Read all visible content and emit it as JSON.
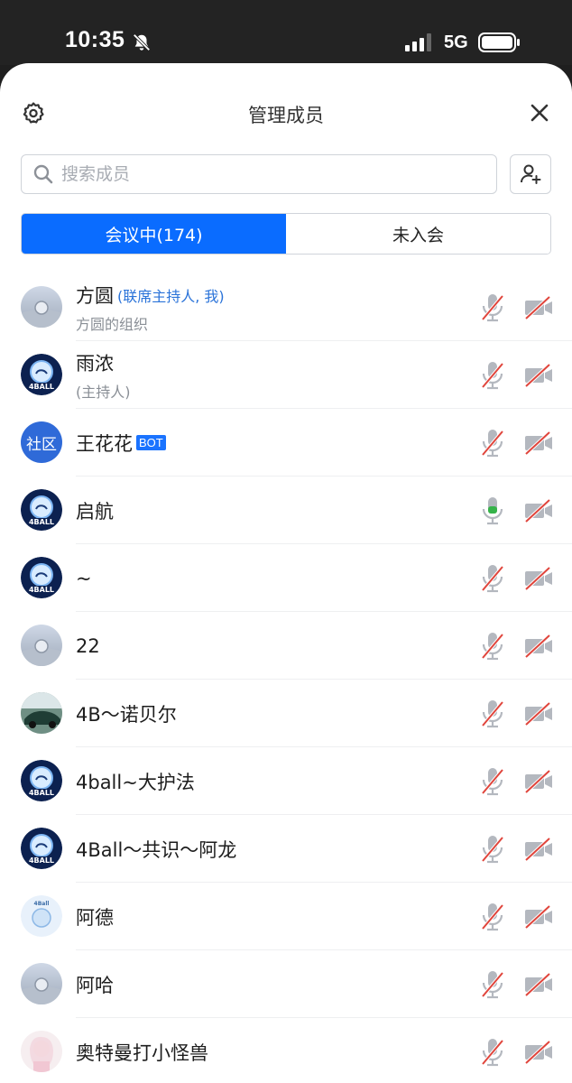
{
  "status_bar": {
    "time": "10:35",
    "network": "5G",
    "icons": [
      "bell-muted-icon",
      "signal-icon",
      "battery-icon"
    ]
  },
  "header": {
    "title": "管理成员",
    "icons": [
      "gear-icon",
      "close-icon"
    ]
  },
  "search": {
    "placeholder": "搜索成员",
    "value": "",
    "icon": "search-icon"
  },
  "add_member_icon": "add-user-icon",
  "tabs": [
    {
      "label": "会议中(174)",
      "active": true
    },
    {
      "label": "未入会",
      "active": false
    }
  ],
  "colors": {
    "accent": "#0a6cff",
    "role_text": "#2a73d9",
    "muted_red": "#e0453c",
    "mic_active": "#36b34a"
  },
  "members": [
    {
      "name": "方圆",
      "role": "(联席主持人, 我)",
      "sub": "方圆的组织",
      "avatar": "road",
      "mic": "muted",
      "camera": "off"
    },
    {
      "name": "雨浓",
      "role": "",
      "sub": "(主持人)",
      "avatar": "4ball",
      "mic": "muted",
      "camera": "off"
    },
    {
      "name": "王花花",
      "badge": "BOT",
      "sub": "",
      "avatar": "text",
      "avatar_text": "社区",
      "mic": "muted",
      "camera": "off"
    },
    {
      "name": "启航",
      "sub": "",
      "avatar": "4ball",
      "mic": "active",
      "camera": "off"
    },
    {
      "name": "~",
      "sub": "",
      "avatar": "4ball",
      "mic": "muted",
      "camera": "off"
    },
    {
      "name": "22",
      "sub": "",
      "avatar": "road",
      "mic": "muted",
      "camera": "off"
    },
    {
      "name": "4B～诺贝尔",
      "sub": "",
      "avatar": "car",
      "mic": "muted",
      "camera": "off"
    },
    {
      "name": "4ball~大护法",
      "sub": "",
      "avatar": "4ball",
      "mic": "muted",
      "camera": "off"
    },
    {
      "name": "4Ball～共识～阿龙",
      "sub": "",
      "avatar": "4ball",
      "mic": "muted",
      "camera": "off"
    },
    {
      "name": "阿德",
      "sub": "",
      "avatar": "4ball-light",
      "mic": "muted",
      "camera": "off"
    },
    {
      "name": "阿哈",
      "sub": "",
      "avatar": "road",
      "mic": "muted",
      "camera": "off"
    },
    {
      "name": "奥特曼打小怪兽",
      "sub": "",
      "avatar": "girl",
      "mic": "muted",
      "camera": "off"
    }
  ]
}
